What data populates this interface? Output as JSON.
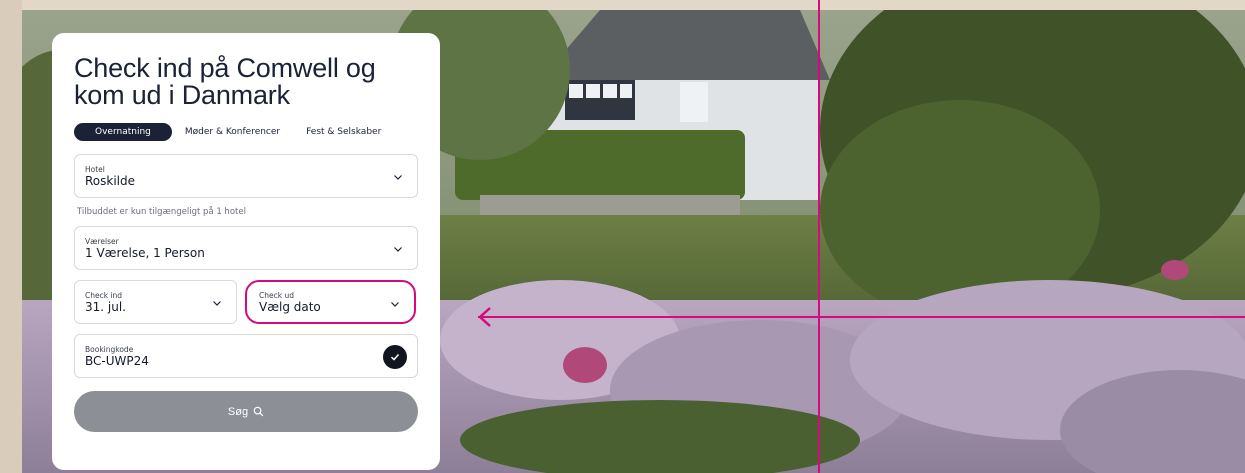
{
  "hero": {
    "title": "Check ind på Comwell og kom ud i Danmark"
  },
  "tabs": [
    {
      "label": "Overnatning",
      "active": true
    },
    {
      "label": "Møder & Konferencer",
      "active": false
    },
    {
      "label": "Fest & Selskaber",
      "active": false
    }
  ],
  "form": {
    "hotel": {
      "label": "Hotel",
      "value": "Roskilde"
    },
    "note": "Tilbuddet er kun tilgængeligt på 1 hotel",
    "rooms": {
      "label": "Værelser",
      "value": "1 Værelse, 1 Person"
    },
    "checkin": {
      "label": "Check ind",
      "value": "31. jul."
    },
    "checkout": {
      "label": "Check ud",
      "value": "Vælg dato"
    },
    "booking_code": {
      "label": "Bookingkode",
      "value": "BC-UWP24"
    },
    "search_label": "Søg"
  },
  "colors": {
    "navy": "#1b2236",
    "highlight": "#d6097f",
    "button_disabled": "#8c9096"
  },
  "icons": [
    "chevron-down-icon",
    "check-icon",
    "search-icon",
    "arrow-left-icon"
  ]
}
